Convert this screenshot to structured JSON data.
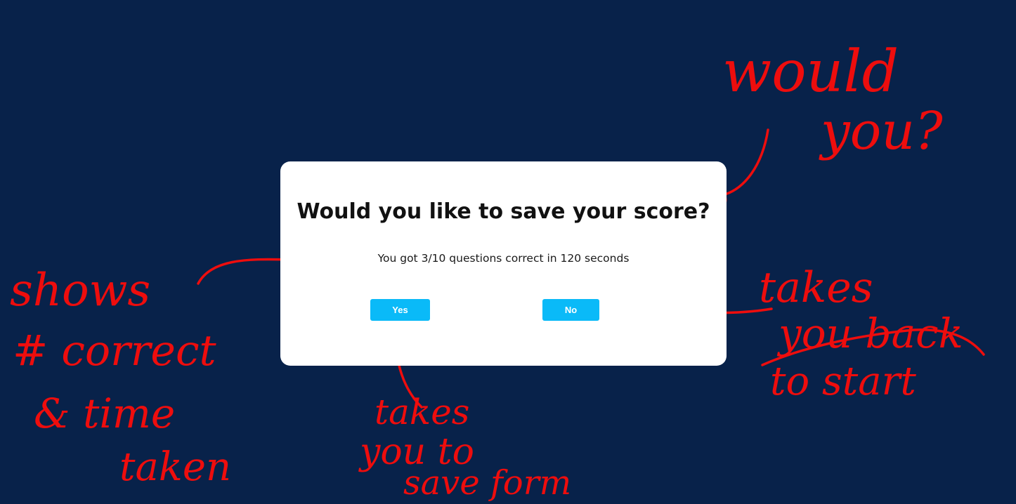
{
  "colors": {
    "background": "#08224a",
    "dialog_background": "#ffffff",
    "button": "#0abaf8",
    "annotation_ink": "#ee0d0d"
  },
  "dialog": {
    "title": "Would you like to save your score?",
    "message": "You got 3/10 questions correct in 120 seconds",
    "yes_label": "Yes",
    "no_label": "No"
  },
  "annotations": {
    "would_you": [
      "would",
      "you?"
    ],
    "shows": [
      "shows",
      "# correct",
      "& time",
      "taken"
    ],
    "save": [
      "takes",
      "you to",
      "save form"
    ],
    "back": [
      "takes",
      "you back",
      "to start"
    ]
  }
}
